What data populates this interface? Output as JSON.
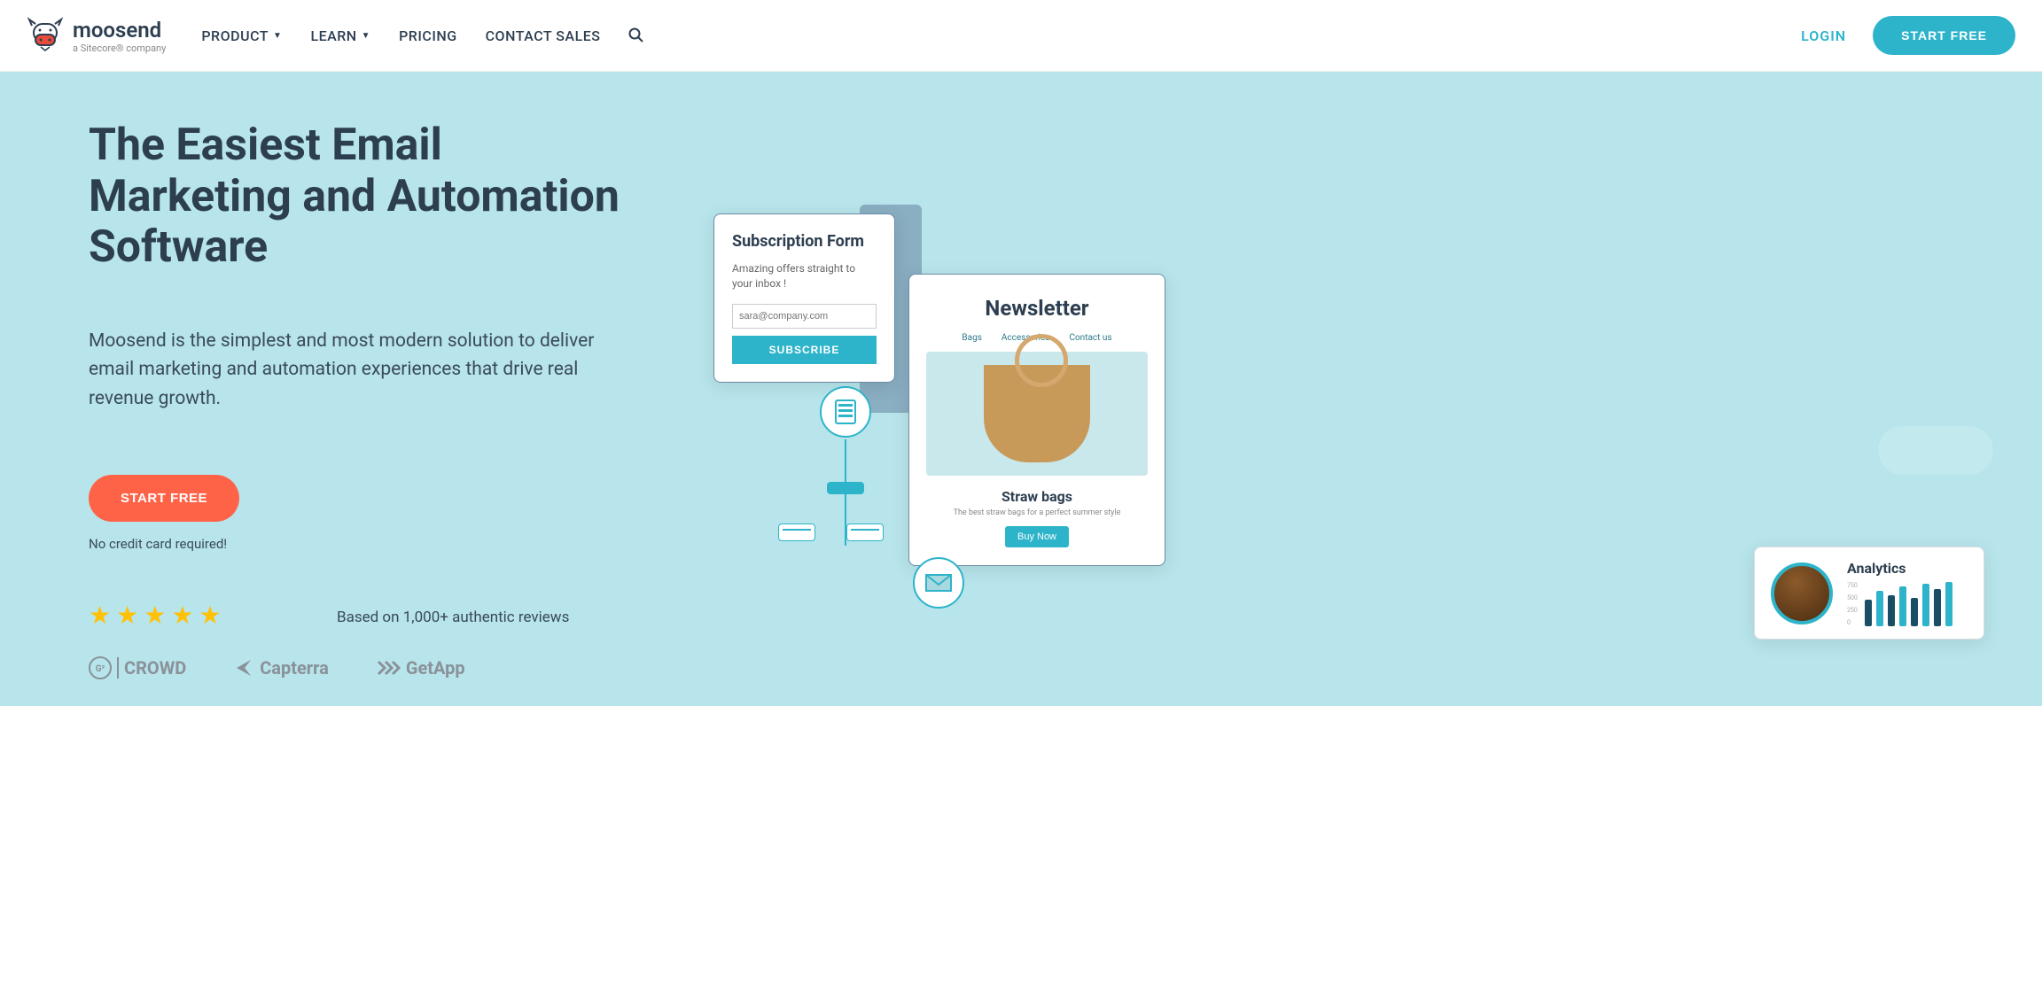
{
  "header": {
    "logo_name": "moosend",
    "logo_tagline": "a Sitecore® company",
    "nav": {
      "product": "PRODUCT",
      "learn": "LEARN",
      "pricing": "PRICING",
      "contact": "CONTACT SALES"
    },
    "login": "LOGIN",
    "start_free": "START FREE"
  },
  "hero": {
    "title": "The Easiest Email Marketing and Automation Software",
    "desc": "Moosend is the simplest and most modern solution to deliver email marketing and automation experiences that drive real revenue growth.",
    "cta": "START FREE",
    "note": "No credit card required!",
    "review_text": "Based on 1,000+ authentic reviews",
    "logos": {
      "g2": "CROWD",
      "capterra": "Capterra",
      "getapp": "GetApp"
    }
  },
  "illus": {
    "sub": {
      "title": "Subscription Form",
      "desc": "Amazing offers straight to your inbox !",
      "placeholder": "sara@company.com",
      "btn": "SUBSCRIBE"
    },
    "nl": {
      "title": "Newsletter",
      "tab1": "Bags",
      "tab2": "Accessories",
      "tab3": "Contact us",
      "product": "Straw bags",
      "sub": "The best straw bags for a perfect summer style",
      "buy": "Buy Now"
    },
    "an": {
      "title": "Analytics",
      "y750": "750",
      "y500": "500",
      "y250": "250",
      "y0": "0"
    }
  }
}
